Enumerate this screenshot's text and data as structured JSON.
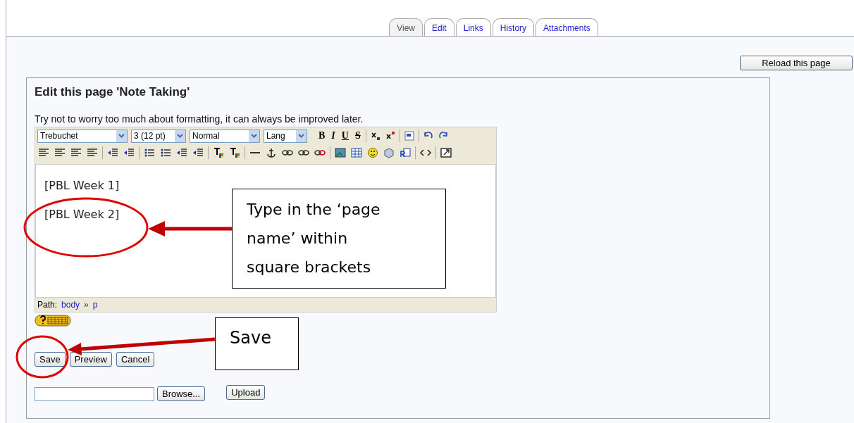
{
  "tabs": [
    {
      "label": "View",
      "selected": true
    },
    {
      "label": "Edit",
      "selected": false
    },
    {
      "label": "Links",
      "selected": false
    },
    {
      "label": "History",
      "selected": false
    },
    {
      "label": "Attachments",
      "selected": false
    }
  ],
  "reload_button": "Reload this page",
  "heading": "Edit this page 'Note Taking'",
  "hint": "Try not to worry too much about formatting, it can always be improved later.",
  "editor": {
    "selects": [
      "Trebuchet",
      "3 (12 pt)",
      "Normal",
      "Lang"
    ],
    "format_buttons": [
      "B",
      "I",
      "U",
      "S"
    ],
    "lines": [
      "[PBL Week 1]",
      "[PBL Week 2]"
    ],
    "path_label": "Path:",
    "path": [
      "body",
      "p"
    ],
    "path_separator": "»"
  },
  "buttons": [
    "Save",
    "Preview",
    "Cancel"
  ],
  "upload": {
    "browse": "Browse...",
    "upload": "Upload"
  },
  "callouts": [
    {
      "text": "Type in the ‘page name’ within square brackets"
    },
    {
      "text": "Save"
    }
  ]
}
